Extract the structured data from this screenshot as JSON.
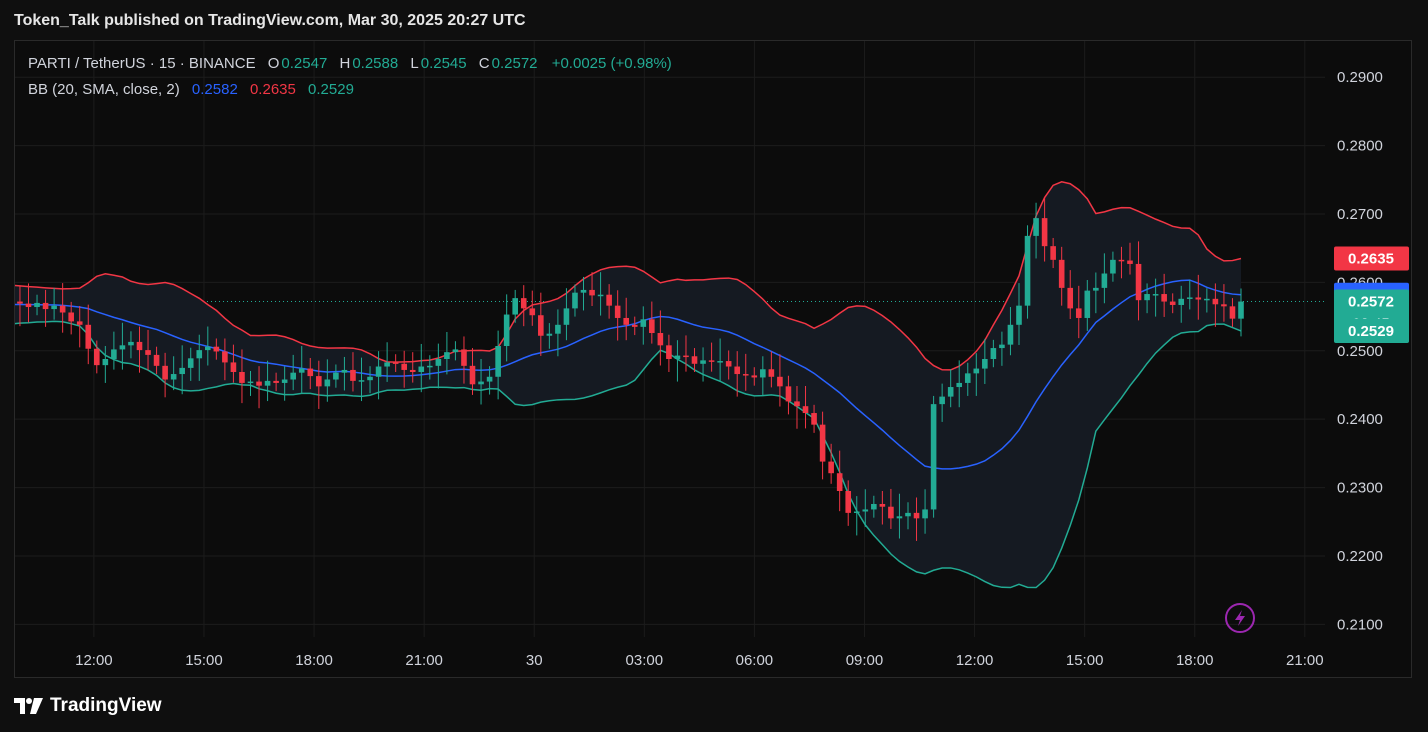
{
  "header": {
    "published": "Token_Talk published on TradingView.com, Mar 30, 2025 20:27 UTC"
  },
  "legend": {
    "symbol": "PARTI / TetherUS · 15 · BINANCE",
    "o_label": "O",
    "o_value": "0.2547",
    "h_label": "H",
    "h_value": "0.2588",
    "l_label": "L",
    "l_value": "0.2545",
    "c_label": "C",
    "c_value": "0.2572",
    "change": "+0.0025 (+0.98%)",
    "bb_label": "BB (20, SMA, close, 2)",
    "bb_basis": "0.2582",
    "bb_upper": "0.2635",
    "bb_lower": "0.2529"
  },
  "price_tags": {
    "upper": "0.2635",
    "basis": "0.2582",
    "last": "0.2572",
    "countdown": "02:45",
    "lower": "0.2529"
  },
  "colors": {
    "up": "#22ab94",
    "down": "#f23645",
    "basis": "#2962ff",
    "upper": "#f23645",
    "lower": "#22ab94",
    "band_fill": "#151a22",
    "grid": "#1c1c1c",
    "lightning": "#9c27b0"
  },
  "icons": {
    "lightning": "lightning-icon",
    "logo": "tradingview-logo"
  },
  "footer": {
    "brand": "TradingView"
  },
  "chart_data": {
    "type": "candlestick",
    "title": "PARTI / TetherUS · 15 · BINANCE",
    "y_ticks": [
      "0.2900",
      "0.2800",
      "0.2700",
      "0.2600",
      "0.2500",
      "0.2400",
      "0.2300",
      "0.2200",
      "0.2100"
    ],
    "x_ticks": [
      "12:00",
      "15:00",
      "18:00",
      "21:00",
      "30",
      "03:00",
      "06:00",
      "09:00",
      "12:00",
      "15:00",
      "18:00",
      "21:00"
    ],
    "ylim": [
      0.2023,
      0.2953
    ],
    "xlim_hours": [
      9.85,
      45.55
    ],
    "x_tick_hours": [
      12,
      15,
      18,
      21,
      24,
      27,
      30,
      33,
      36,
      39,
      42,
      45
    ],
    "grid": true,
    "candle_closes": [
      0.2548,
      0.2572,
      0.2568,
      0.2585,
      0.2578,
      0.2592,
      0.2575,
      0.256,
      0.2542,
      0.2553,
      0.2566,
      0.2572,
      0.2569,
      0.2564,
      0.257,
      0.2561,
      0.2566,
      0.2556,
      0.2543,
      0.2538,
      0.2503,
      0.2479,
      0.2488,
      0.2502,
      0.2508,
      0.2513,
      0.2501,
      0.2494,
      0.2478,
      0.2458,
      0.2466,
      0.2475,
      0.2489,
      0.2501,
      0.2506,
      0.2499,
      0.2483,
      0.2469,
      0.2453,
      0.2455,
      0.2449,
      0.2456,
      0.2453,
      0.2458,
      0.2468,
      0.2474,
      0.2463,
      0.2448,
      0.2458,
      0.2468,
      0.2472,
      0.2456,
      0.2457,
      0.2462,
      0.2477,
      0.2483,
      0.2481,
      0.2472,
      0.2469,
      0.2477,
      0.2478,
      0.2488,
      0.2498,
      0.2502,
      0.2478,
      0.2451,
      0.2455,
      0.2462,
      0.2507,
      0.2553,
      0.2577,
      0.2562,
      0.2552,
      0.2522,
      0.2525,
      0.2538,
      0.2562,
      0.2585,
      0.2589,
      0.2581,
      0.2582,
      0.2566,
      0.2548,
      0.2538,
      0.2535,
      0.2546,
      0.2526,
      0.2508,
      0.2488,
      0.2493,
      0.2492,
      0.2481,
      0.2486,
      0.2485,
      0.2485,
      0.2477,
      0.2466,
      0.2464,
      0.2461,
      0.2473,
      0.2462,
      0.2448,
      0.2426,
      0.2419,
      0.2409,
      0.2392,
      0.2338,
      0.2321,
      0.2295,
      0.2263,
      0.2265,
      0.2268,
      0.2276,
      0.2272,
      0.2255,
      0.2258,
      0.2263,
      0.2255,
      0.2268,
      0.2422,
      0.2433,
      0.2447,
      0.2453,
      0.2467,
      0.2474,
      0.2488,
      0.2504,
      0.2509,
      0.2538,
      0.2566,
      0.2668,
      0.2694,
      0.2653,
      0.2633,
      0.2592,
      0.2562,
      0.2548,
      0.2588,
      0.2592,
      0.2613,
      0.2633,
      0.2632,
      0.2627,
      0.2574,
      0.2583,
      0.2583,
      0.2572,
      0.2567,
      0.2576,
      0.2578,
      0.2575,
      0.2576,
      0.2568,
      0.2565,
      0.2547,
      0.2572
    ]
  }
}
